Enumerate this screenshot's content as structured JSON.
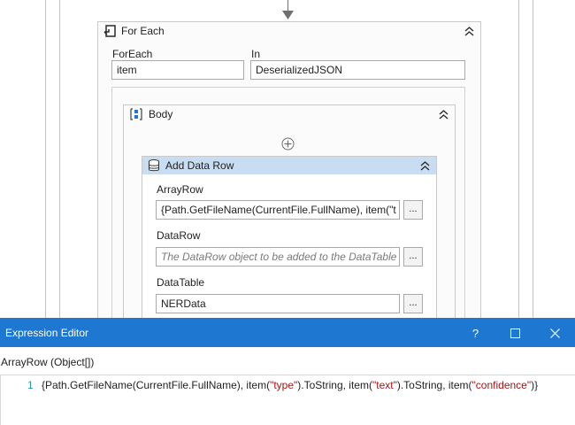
{
  "foreach": {
    "title": "For Each",
    "foreach_label": "ForEach",
    "foreach_value": "item",
    "in_label": "In",
    "in_value": "DeserializedJSON"
  },
  "body_container": {
    "title": "Body"
  },
  "add_data_row": {
    "title": "Add Data Row",
    "array_row_label": "ArrayRow",
    "array_row_value": "{Path.GetFileName(CurrentFile.FullName), item(\"t",
    "data_row_label": "DataRow",
    "data_row_placeholder": "The DataRow object to be added to the DataTable",
    "data_table_label": "DataTable",
    "data_table_value": "NERData",
    "dots": "..."
  },
  "editor": {
    "title": "Expression Editor",
    "help": "?",
    "maximize": "☐",
    "close": "✕",
    "param_label": "ArrayRow (Object[])",
    "line_number": "1",
    "code": {
      "p1": "{Path.GetFileName(CurrentFile.FullName), item(",
      "s1": "\"type\"",
      "p2": ").ToString, item(",
      "s2": "\"text\"",
      "p3": ").ToString, item(",
      "s3": "\"confidence\"",
      "p4": ")}"
    }
  },
  "colors": {
    "accent": "#1e78d2",
    "header_fill": "#c9ddf2",
    "string": "#a31515"
  }
}
